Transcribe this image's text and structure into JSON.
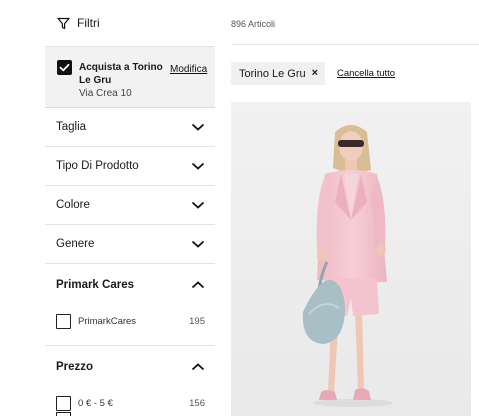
{
  "filters": {
    "title": "Filtri",
    "icon": "filter-funnel-icon",
    "store": {
      "checked": true,
      "title": "Acquista a Torino Le Gru",
      "address": "Via Crea 10",
      "modify_label": "Modifica"
    },
    "sections": [
      {
        "label": "Taglia",
        "expanded": false
      },
      {
        "label": "Tipo Di Prodotto",
        "expanded": false
      },
      {
        "label": "Colore",
        "expanded": false
      },
      {
        "label": "Genere",
        "expanded": false
      },
      {
        "label": "Primark Cares",
        "expanded": true,
        "options": [
          {
            "label": "PrimarkCares",
            "count": "195",
            "checked": false
          }
        ]
      },
      {
        "label": "Prezzo",
        "expanded": true,
        "options": [
          {
            "label": "0 € - 5 €",
            "count": "156",
            "checked": false
          }
        ]
      }
    ]
  },
  "results": {
    "count_label": "896 Articoli",
    "active_filters": [
      {
        "label": "Torino Le Gru",
        "remove_icon": "close-icon"
      }
    ],
    "clear_all_label": "Cancella tutto",
    "product_image": "woman-in-pink-blazer-suit-with-blue-handbag"
  },
  "colors": {
    "sidebar_highlight": "#f2f2f2",
    "chip_background": "#f0f0f0",
    "text": "#1a1a1a",
    "suit_pink": "#f4c6cf",
    "bag_blue": "#a9bfc6"
  }
}
